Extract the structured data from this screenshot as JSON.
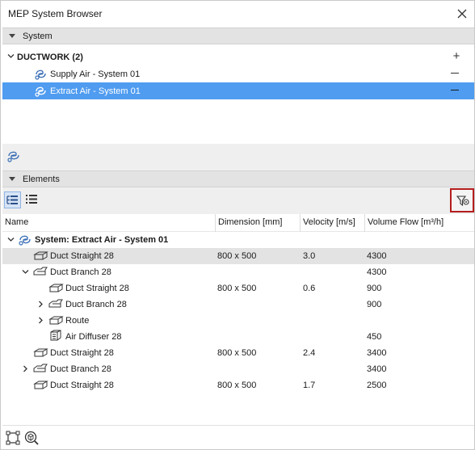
{
  "window": {
    "title": "MEP System Browser"
  },
  "icons": {
    "close": "close-icon",
    "system": "air-system-icon",
    "duct_straight": "duct-straight-icon",
    "duct_branch": "duct-branch-icon",
    "route": "route-icon",
    "air_diffuser": "air-diffuser-icon",
    "filter": "filter-settings-icon",
    "tree_view": "tree-view-icon",
    "list_view": "list-view-icon",
    "select_elements": "select-elements-icon",
    "zoom_to": "zoom-to-selection-icon"
  },
  "colors": {
    "selection": "#4f9cf0",
    "section_header": "#e3e3e3",
    "filter_highlight": "#b51d1d"
  },
  "system_section": {
    "header": "System",
    "group": {
      "label": "DUCTWORK (2)",
      "add_symbol": "+"
    },
    "systems": [
      {
        "label": "Supply Air - System 01",
        "selected": false
      },
      {
        "label": "Extract Air - System 01",
        "selected": true
      }
    ]
  },
  "elements_section": {
    "header": "Elements",
    "columns": {
      "name": "Name",
      "dimension": "Dimension [mm]",
      "velocity": "Velocity [m/s]",
      "volume_flow": "Volume Flow [m³/h]"
    },
    "root": {
      "label": "System: Extract Air - System 01"
    },
    "rows": [
      {
        "name": "Duct Straight 28",
        "dimension": "800 x 500",
        "velocity": "3.0",
        "flow": "4300"
      },
      {
        "name": "Duct Branch 28",
        "dimension": "",
        "velocity": "",
        "flow": "4300"
      },
      {
        "name": "Duct Straight 28",
        "dimension": "800 x 500",
        "velocity": "0.6",
        "flow": "900"
      },
      {
        "name": "Duct Branch 28",
        "dimension": "",
        "velocity": "",
        "flow": "900"
      },
      {
        "name": "Route",
        "dimension": "",
        "velocity": "",
        "flow": ""
      },
      {
        "name": "Air Diffuser 28",
        "dimension": "",
        "velocity": "",
        "flow": "450"
      },
      {
        "name": "Duct Straight 28",
        "dimension": "800 x 500",
        "velocity": "2.4",
        "flow": "3400"
      },
      {
        "name": "Duct Branch 28",
        "dimension": "",
        "velocity": "",
        "flow": "3400"
      },
      {
        "name": "Duct Straight 28",
        "dimension": "800 x 500",
        "velocity": "1.7",
        "flow": "2500"
      }
    ]
  }
}
